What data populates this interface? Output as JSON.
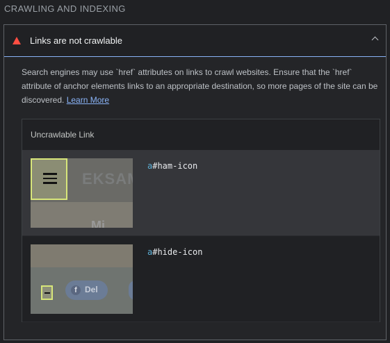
{
  "section": {
    "title": "CRAWLING AND INDEXING"
  },
  "audit": {
    "title": "Links are not crawlable",
    "description_prefix": "Search engines may use `href` attributes on links to crawl websites. Ensure that the `href` attribute of anchor elements links to an appropriate destination, so more pages of the site can be discovered. ",
    "learn_more": "Learn More",
    "icons": {
      "warning": "warning-icon",
      "collapse": "chevron-up-icon"
    },
    "colors": {
      "warning": "#ff4e42",
      "link": "#8ab4f8",
      "highlight": "#d8e67a"
    }
  },
  "table": {
    "header": "Uncrawlable Link",
    "rows": [
      {
        "selector_tag": "a",
        "selector_rest": "#ham-icon",
        "thumbnail_text": "EKSAM",
        "thumbnail_subtext": "Mi"
      },
      {
        "selector_tag": "a",
        "selector_rest": "#hide-icon",
        "thumbnail_button": "Del"
      }
    ]
  }
}
